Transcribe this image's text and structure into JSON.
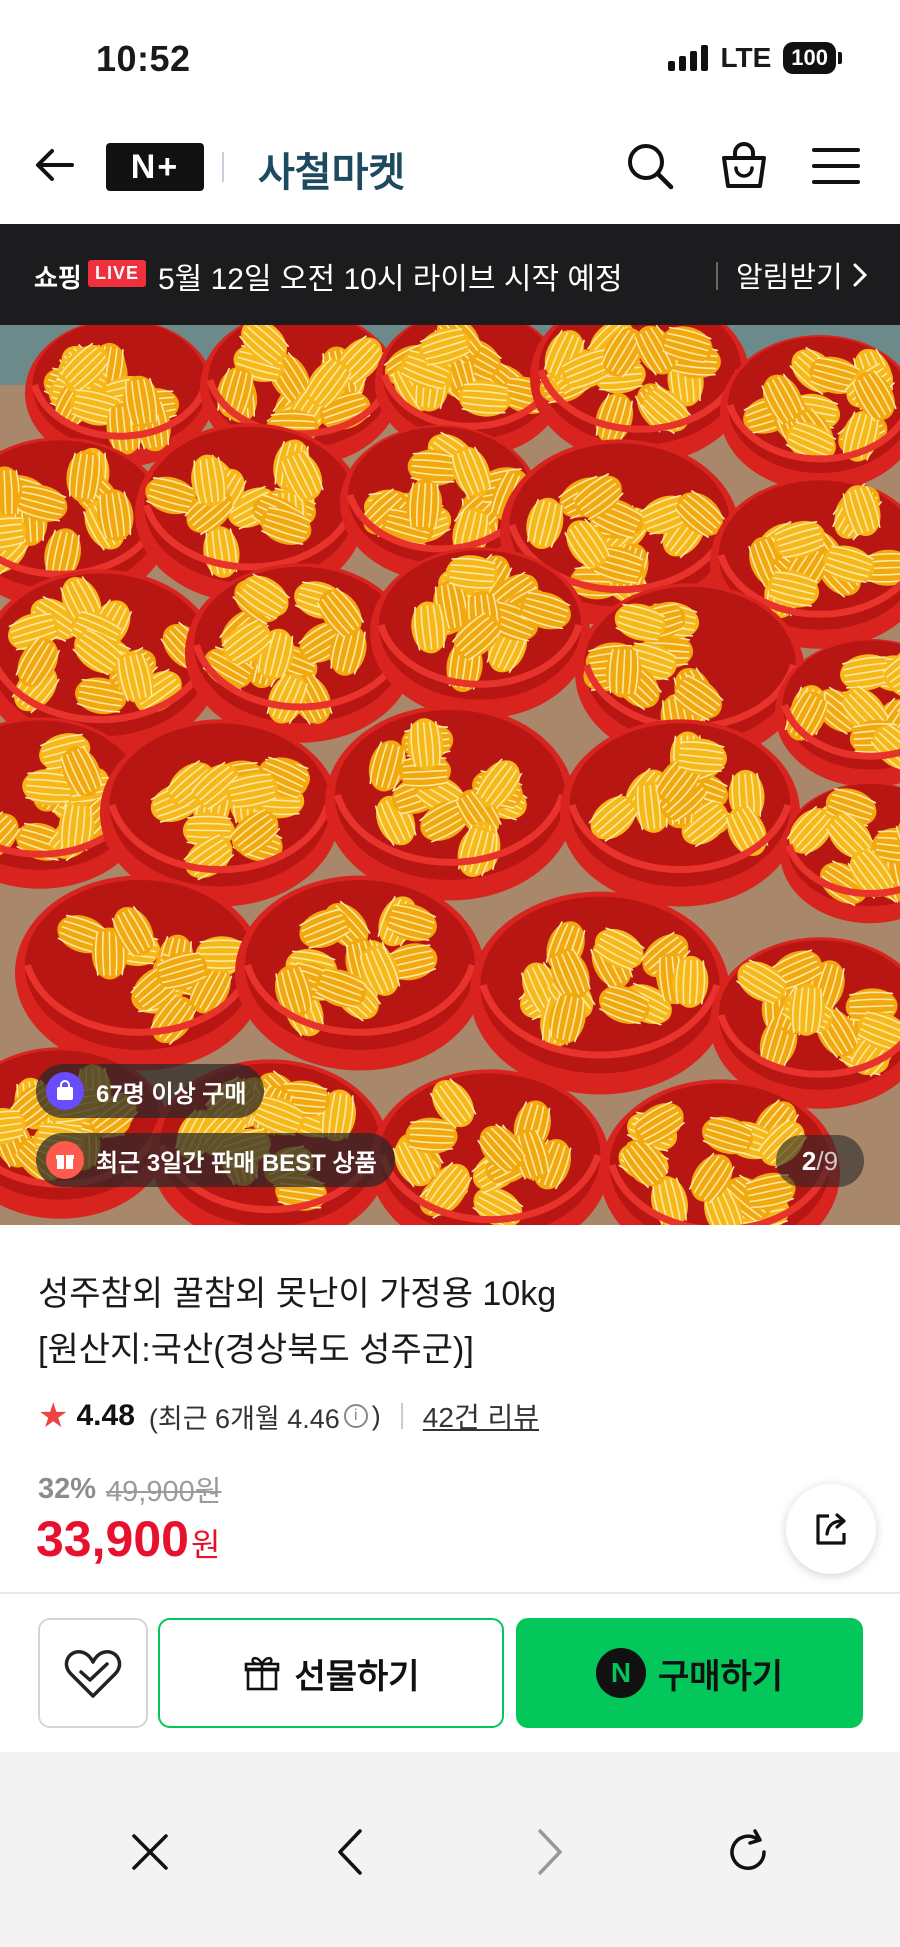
{
  "status_bar": {
    "time": "10:52",
    "network": "LTE",
    "battery": "100"
  },
  "header": {
    "logo": "N+",
    "store_name": "사철마켓",
    "icons": [
      "back-arrow-icon",
      "search-icon",
      "shopping-bag-icon",
      "hamburger-menu-icon"
    ]
  },
  "live_banner": {
    "label": "쇼핑",
    "badge": "LIVE",
    "message": "5월 12일 오전 10시 라이브 시작 예정",
    "notify": "알림받기"
  },
  "gallery": {
    "badges": [
      "67명 이상 구매",
      "최근 3일간 판매 BEST 상품"
    ],
    "current": "2",
    "total": "9"
  },
  "product": {
    "title_line1": "성주참외 꿀참외 못난이 가정용 10kg",
    "title_line2": "[원산지:국산(경상북도 성주군)]",
    "rating": "4.48",
    "rating_recent_prefix": "(최근 6개월 4.46",
    "rating_recent_suffix": ")",
    "reviews": "42건 리뷰",
    "discount": "32%",
    "original_price": "49,900원",
    "price": "33,900",
    "currency": "원"
  },
  "actions": {
    "gift": "선물하기",
    "purchase": "구매하기",
    "npay_letter": "N"
  },
  "colors": {
    "brand_green": "#03c75a",
    "price_red": "#e8112d",
    "store_name": "#1d4a5e",
    "live_red": "#f0303c",
    "banner_bg": "#1c1c1e"
  }
}
